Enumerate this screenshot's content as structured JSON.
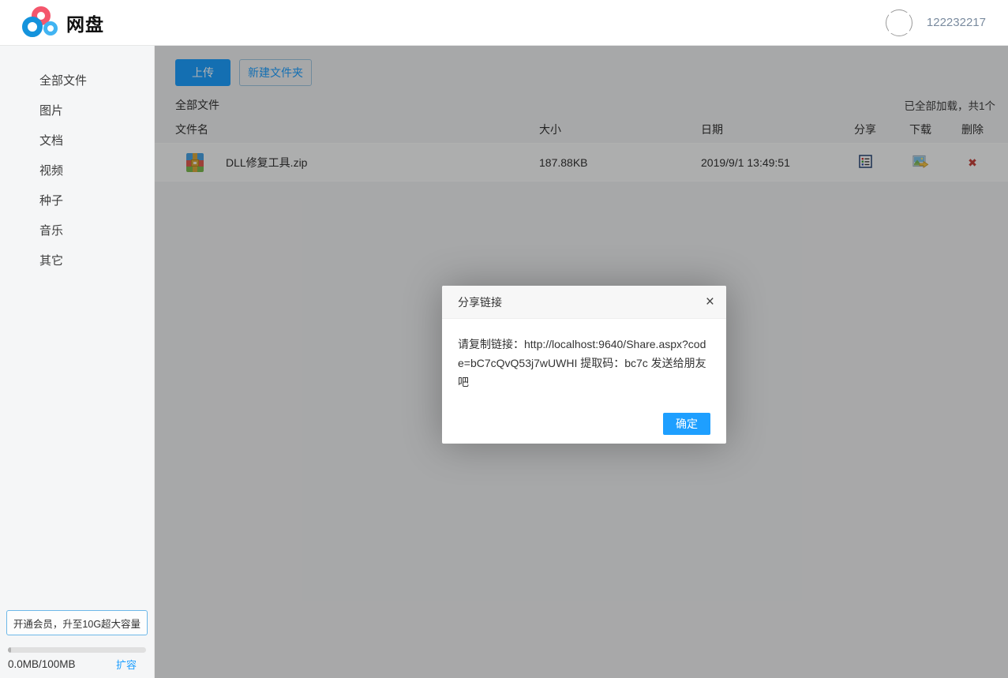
{
  "header": {
    "app_title": "网盘",
    "username": "122232217"
  },
  "sidebar": {
    "items": [
      "全部文件",
      "图片",
      "文档",
      "视频",
      "种子",
      "音乐",
      "其它"
    ],
    "vip_button": "开通会员，升至10G超大容量",
    "storage_used": "0.0MB/100MB",
    "expand_link": "扩容",
    "progress_percent": 2
  },
  "toolbar": {
    "upload": "上传",
    "new_folder": "新建文件夹"
  },
  "file_list": {
    "breadcrumb": "全部文件",
    "load_status": "已全部加载，共1个",
    "columns": [
      "文件名",
      "大小",
      "日期",
      "分享",
      "下载",
      "删除"
    ],
    "rows": [
      {
        "name": "DLL修复工具.zip",
        "size": "187.88KB",
        "date": "2019/9/1 13:49:51"
      }
    ]
  },
  "dialog": {
    "title": "分享链接",
    "body": "请复制链接：http://localhost:9640/Share.aspx?code=bC7cQvQ53j7wUWHI 提取码：bc7c 发送给朋友吧",
    "ok": "确定",
    "close_glyph": "×"
  },
  "icons": {
    "logo": "cloud-rings-logo",
    "avatar": "broken-image-placeholder",
    "file": "zip-archive-icon",
    "share": "detail-list-icon",
    "download": "image-export-icon",
    "delete_glyph": "✖"
  },
  "colors": {
    "accent": "#1E9FFF",
    "logo_blue": "#1493dc",
    "logo_pink": "#f4566c",
    "logo_lightblue": "#41b4f2",
    "delete_red": "#c5433c"
  }
}
